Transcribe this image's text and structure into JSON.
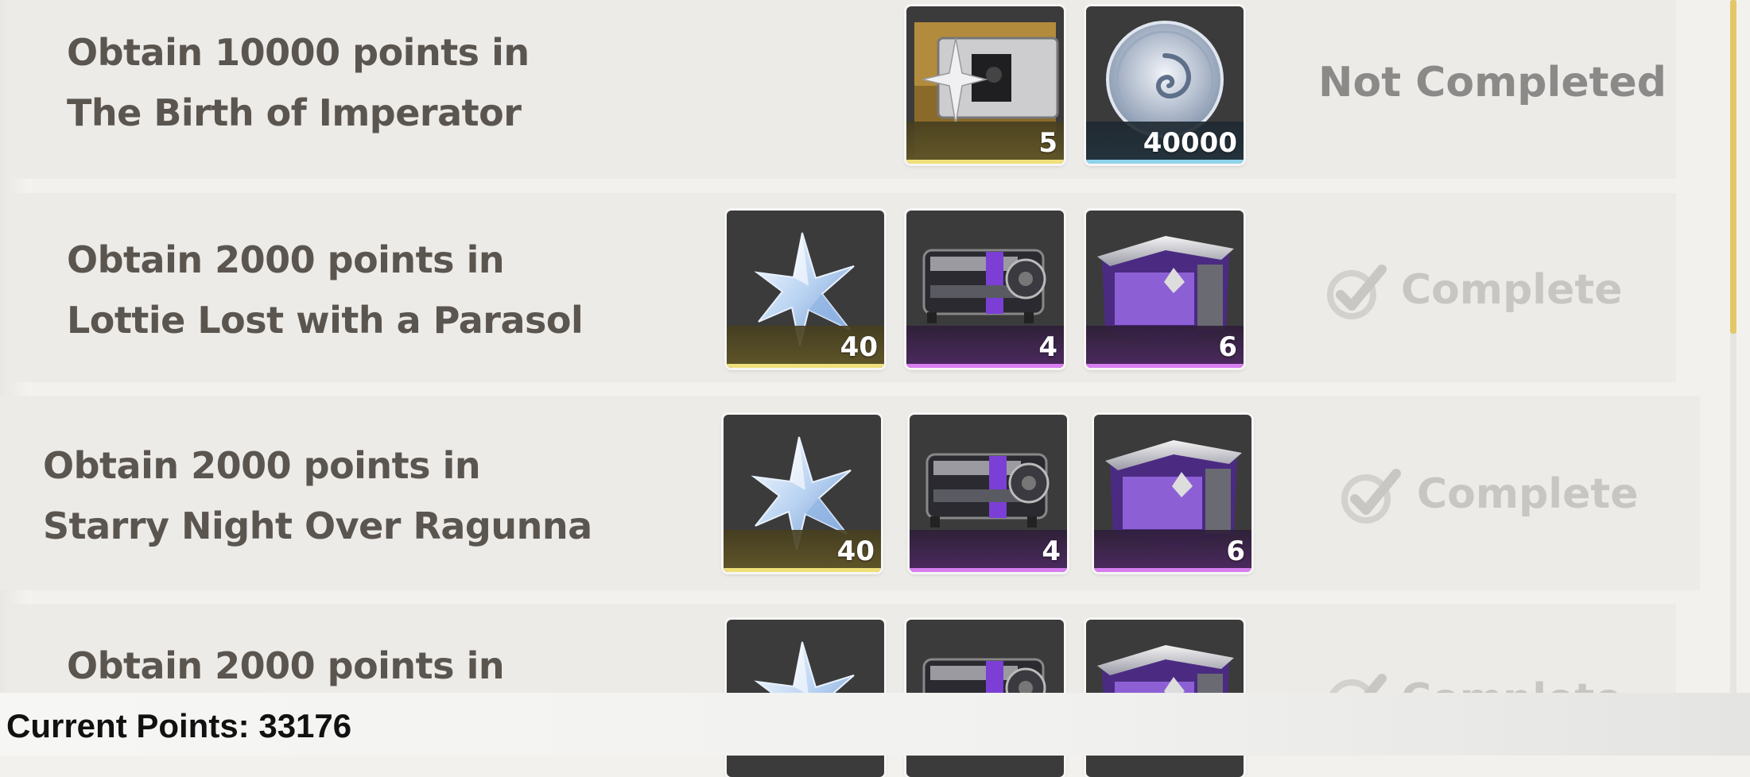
{
  "tasks": [
    {
      "line1": "Obtain 10000 points in",
      "line2": "The Birth of Imperator",
      "status": "Not Completed",
      "rewards": [
        {
          "icon": "star-box-icon",
          "count": "5",
          "rarity": "gold"
        },
        {
          "icon": "silver-coin-icon",
          "count": "40000",
          "rarity": "blue"
        }
      ]
    },
    {
      "line1": "Obtain 2000 points in",
      "line2": "Lottie Lost with a Parasol",
      "status": "Complete",
      "rewards": [
        {
          "icon": "crystal-star-icon",
          "count": "40",
          "rarity": "gold"
        },
        {
          "icon": "dark-capsule-icon",
          "count": "4",
          "rarity": "purple"
        },
        {
          "icon": "purple-crate-icon",
          "count": "6",
          "rarity": "purple"
        }
      ]
    },
    {
      "line1": "Obtain 2000 points in",
      "line2": "Starry Night Over Ragunna",
      "status": "Complete",
      "rewards": [
        {
          "icon": "crystal-star-icon",
          "count": "40",
          "rarity": "gold"
        },
        {
          "icon": "dark-capsule-icon",
          "count": "4",
          "rarity": "purple"
        },
        {
          "icon": "purple-crate-icon",
          "count": "6",
          "rarity": "purple"
        }
      ]
    },
    {
      "line1": "Obtain 2000 points in",
      "status": "Complete"
    }
  ],
  "footer": {
    "current_points": "Current Points: 33176"
  },
  "colors": {
    "gold": "#efe07a",
    "blue": "#8fd3ea",
    "purple": "#d77ef0",
    "accent": "#e2c86a"
  }
}
